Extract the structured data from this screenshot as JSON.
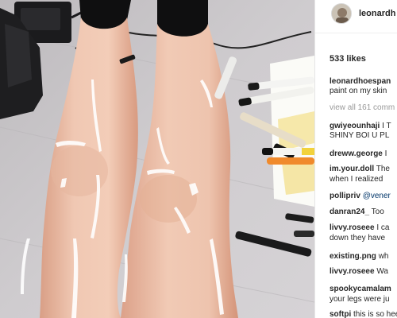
{
  "post": {
    "username": "leonardh",
    "likes": "533 likes",
    "view_all_comments": "view all 161 comm"
  },
  "comments": [
    {
      "user": "leonardhoespan",
      "lines": [
        "paint on my skin"
      ]
    },
    {
      "user": "gwiyeounhaji",
      "text": "I T",
      "lines": [
        "SHINY BOI U PL"
      ]
    },
    {
      "user": "dreww.george",
      "text": "I"
    },
    {
      "user": "im.your.doll",
      "text": "The",
      "lines": [
        "when I realized"
      ]
    },
    {
      "user": "pollipriv",
      "mention": "@vener"
    },
    {
      "user": "danran24_",
      "text": "Too"
    },
    {
      "user": "livvy.roseee",
      "text": "I ca",
      "lines": [
        "down they have"
      ]
    },
    {
      "user": "existing.png",
      "text": "wh"
    },
    {
      "user": "livvy.roseee",
      "text": "Wa"
    },
    {
      "user": "spookycamalam",
      "lines": [
        "your legs were ju"
      ]
    },
    {
      "user": "softpi",
      "text": "this is so hee"
    }
  ],
  "colors": {
    "floor": "#c9c6c9",
    "skin": "#ecc1ab",
    "text_primary": "#262626",
    "text_muted": "#999999"
  },
  "icons": [
    "avatar-image"
  ]
}
